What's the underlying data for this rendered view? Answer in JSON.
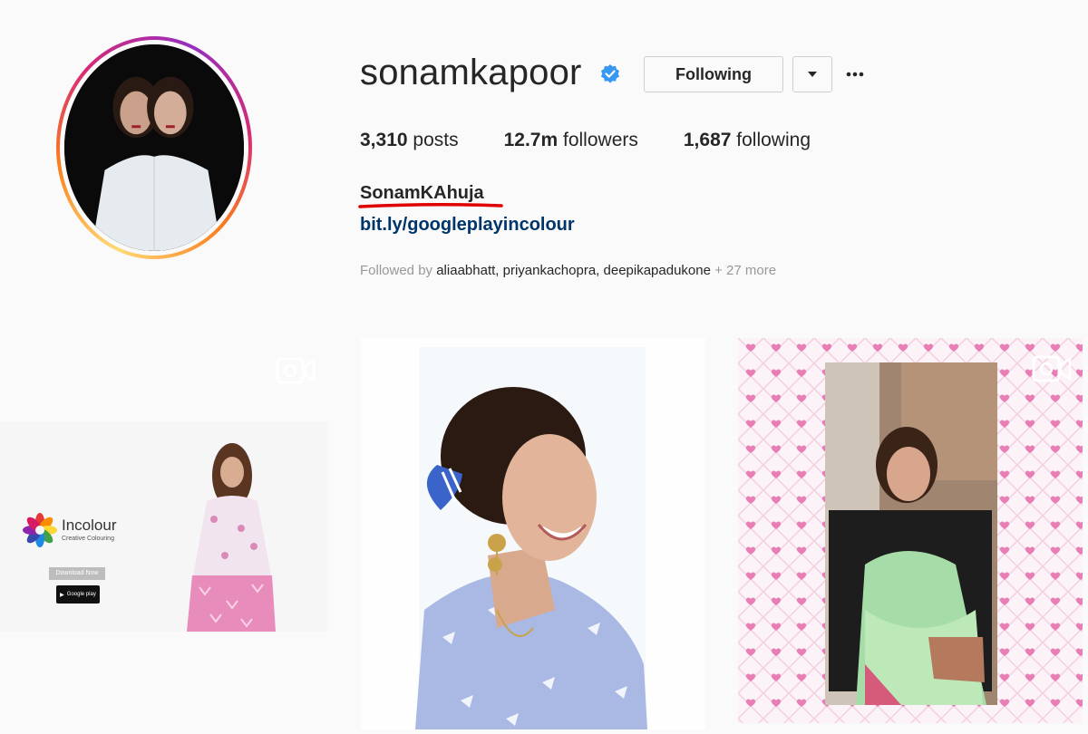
{
  "profile": {
    "username": "sonamkapoor",
    "verified": true,
    "follow_button": "Following",
    "stats": {
      "posts_count": "3,310",
      "posts_label": "posts",
      "followers_count": "12.7m",
      "followers_label": "followers",
      "following_count": "1,687",
      "following_label": "following"
    },
    "full_name": "SonamKAhuja",
    "bio_link": "bit.ly/googleplayincolour",
    "followed_by": {
      "prefix": "Followed by",
      "names": "aliaabhatt, priyankachopra, deepikapadukone",
      "suffix": "+ 27 more"
    }
  },
  "icons": {
    "verified": "verified-badge-icon",
    "dropdown": "caret-down-icon",
    "more": "more-options-icon",
    "video": "video-camera-icon"
  },
  "grid": {
    "post1": {
      "app_name": "Incolour",
      "app_tagline": "Creative Colouring",
      "download_label": "Download Now",
      "store_badge": "Google play"
    }
  },
  "colors": {
    "link": "#003569",
    "verified": "#3897f0",
    "underline": "#e00000",
    "muted": "#999999"
  }
}
